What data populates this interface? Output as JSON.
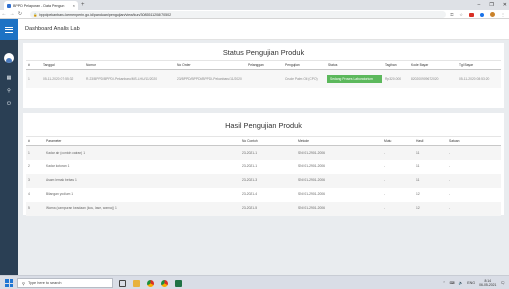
{
  "browser": {
    "tab_title": "BPPD Pelaporan - Data Pengun",
    "tab_close": "×",
    "new_tab": "+",
    "url": "bppdpekanbaru.kemenperin.go.id/panduan/pengujian/view/kun/3085511208/70502",
    "controls": {
      "minimize": "–",
      "maximize": "❐",
      "close": "✕"
    }
  },
  "header": {
    "title": "Dashboard Analis Lab"
  },
  "status_section": {
    "title": "Status Pengujian Produk",
    "columns": [
      "#",
      "Tanggal",
      "Nomor",
      "No Order",
      "Pelanggan",
      "Pengujian",
      "Status",
      "Tagihan",
      "Kode Bayar",
      "Tgl Bayar"
    ],
    "rows": [
      {
        "no": "1",
        "tanggal": "05-11-2020 07:55:32",
        "nomor": "R-23/BPPD/BPPDI-Pekanbaru/MS-LHU/11/2020",
        "no_order": "23/BPPD/BPPDI/BPPDI-Pekanbaru/11/2020",
        "pelanggan": "",
        "pengujian": "Crude Palm Oil (CPO)",
        "status": "Sedang Proses Laboratorium",
        "tagihan": "Rp320.000",
        "kode_bayar": "820200909672020",
        "tgl_bayar": "05-11-2020 08:53:20"
      }
    ]
  },
  "hasil_section": {
    "title": "Hasil Pengujian Produk",
    "columns": [
      "#",
      "Parameter",
      "No Contoh",
      "Metode",
      "Mutu",
      "Hasil",
      "Satuan"
    ],
    "rows": [
      {
        "no": "1",
        "parameter": "Kadar air (contoh cairan) 1",
        "no_contoh": "23-2021-1",
        "metode": "SNI 01-2901-2006",
        "mutu": "-",
        "hasil": "11",
        "satuan": "-"
      },
      {
        "no": "2",
        "parameter": "Kadar kotoran 1",
        "no_contoh": "23-2021-1",
        "metode": "SNI 01-2901-2006",
        "mutu": "-",
        "hasil": "11",
        "satuan": "-"
      },
      {
        "no": "3",
        "parameter": "Asam lemak bebas 1",
        "no_contoh": "23-2021-3",
        "metode": "SNI 01-2901-2006",
        "mutu": "-",
        "hasil": "11",
        "satuan": "-"
      },
      {
        "no": "4",
        "parameter": "Bilangan yodium 1",
        "no_contoh": "23-2021-4",
        "metode": "SNI 01-2901-2006",
        "mutu": "-",
        "hasil": "12",
        "satuan": "-"
      },
      {
        "no": "5",
        "parameter": "Warna (campuran keadaan (kou, lase, warna)) 1",
        "no_contoh": "23-2021-5",
        "metode": "SNI 01-2901-2006",
        "mutu": "-",
        "hasil": "12",
        "satuan": "-"
      }
    ]
  },
  "taskbar": {
    "search_placeholder": "Type here to search",
    "time": "8:14",
    "date": "06-05-2021",
    "lang": "ENG"
  },
  "colors": {
    "sidebar": "#2a3f54",
    "accent": "#1d72c4",
    "status_green": "#5cb85c"
  },
  "icons": {
    "sidebar": [
      "menu-icon",
      "avatar",
      "grid-icon",
      "map-pin-icon",
      "power-icon"
    ]
  }
}
